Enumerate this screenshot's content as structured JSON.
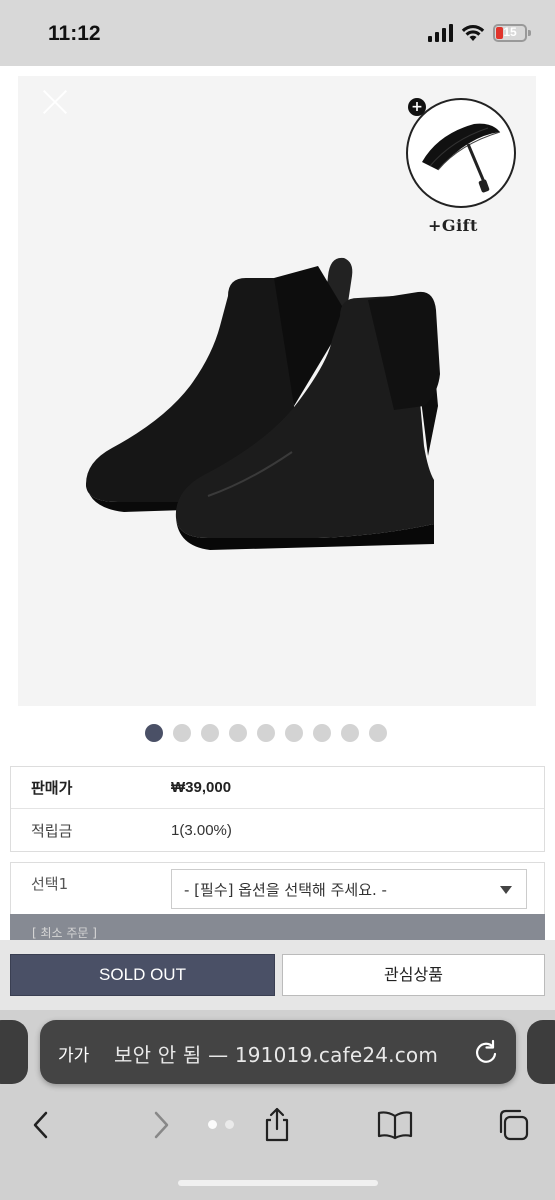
{
  "status": {
    "time": "11:12",
    "battery": "15",
    "battery_color": "#e0342c"
  },
  "hero": {
    "gift_label": "+Gift",
    "gift_plus": "+",
    "gallery_count": 9,
    "gallery_active_index": 0
  },
  "product": {
    "price_label": "판매가",
    "price_value": "₩39,000",
    "points_label": "적립금",
    "points_value": "1(3.00%)",
    "option_label": "선택1",
    "option_placeholder": "- [필수] 옵션을 선택해 주세요. -",
    "option_below": "[ 최소 주문 ]"
  },
  "actions": {
    "sold_out_label": "SOLD OUT",
    "wishlist_label": "관심상품",
    "accent_color": "#4a5066"
  },
  "browser": {
    "aa_label": "가가",
    "url_text": "보안 안 됨 — 191019.cafe24.com"
  }
}
